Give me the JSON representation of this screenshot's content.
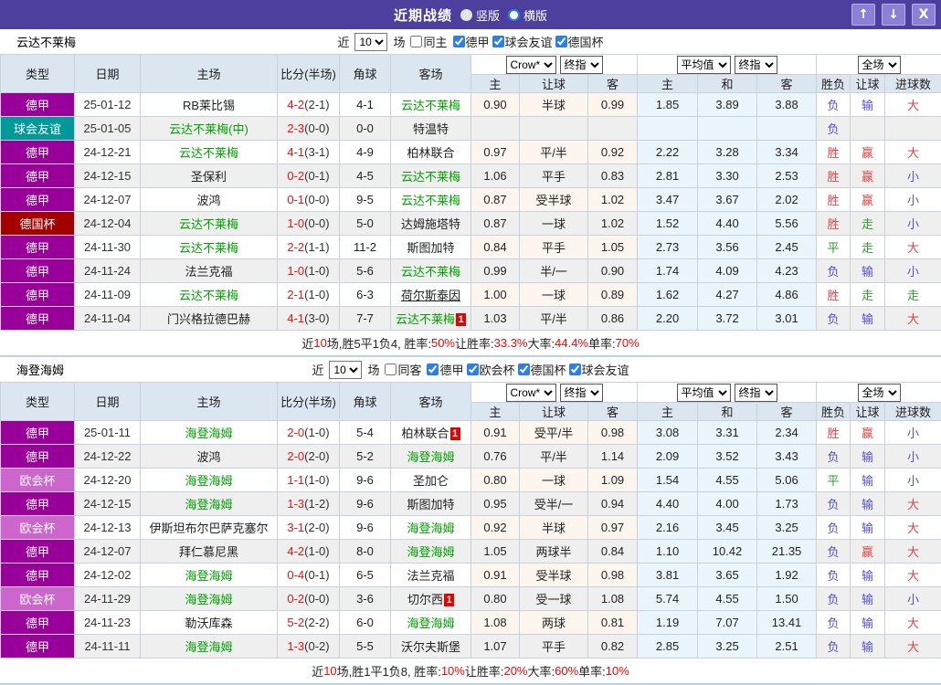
{
  "titlebar": {
    "title": "近期战绩",
    "radios": [
      {
        "label": "竖版",
        "selected": true
      },
      {
        "label": "横版",
        "selected": false
      }
    ],
    "buttons": {
      "up": "↑",
      "down": "↓",
      "close": "X"
    }
  },
  "filter_labels": {
    "near": "近",
    "games": "场"
  },
  "hdr": {
    "cols": [
      "类型",
      "日期",
      "主场",
      "比分(半场)",
      "角球",
      "客场"
    ],
    "crow_sel": "Crow*",
    "end_sel": "终指",
    "avg_sel": "平均值",
    "full_sel": "全场",
    "sub": [
      "主",
      "让球",
      "客",
      "主",
      "和",
      "客",
      "胜负",
      "让球",
      "进球数"
    ]
  },
  "colors": {
    "titlebar": "#4c3f9d",
    "leagues": {
      "德甲": "#990099",
      "球会友谊": "#009999",
      "德国杯": "#a50000",
      "欧会杯": "#cc66cc"
    },
    "win_red": "#e04545",
    "lose_blue": "#5252cf",
    "walk_green": "#2f9e2f",
    "team_green": "#00a000",
    "score_red": "#f01010"
  },
  "sections": [
    {
      "team": "云达不莱梅",
      "count": "10",
      "same_label": "同主",
      "same_checked": false,
      "leagues": [
        {
          "label": "德甲",
          "checked": true
        },
        {
          "label": "球会友谊",
          "checked": true
        },
        {
          "label": "德国杯",
          "checked": true
        }
      ],
      "rows": [
        {
          "lg": "德甲",
          "dt": "25-01-12",
          "h": {
            "t": "RB莱比锡"
          },
          "s": "4-2",
          "hs": "(2-1)",
          "cn": "4-1",
          "a": {
            "t": "云达不莱梅",
            "g": 1
          },
          "cw": [
            "0.90",
            "半球",
            "0.99"
          ],
          "av": [
            "1.85",
            "3.89",
            "3.88"
          ],
          "rs": [
            [
              "负",
              "b"
            ],
            [
              "输",
              "b"
            ],
            [
              "大",
              "r"
            ]
          ]
        },
        {
          "lg": "球会友谊",
          "dt": "25-01-05",
          "h": {
            "t": "云达不莱梅(中)",
            "g": 1
          },
          "s": "2-3",
          "hs": "(0-0)",
          "cn": "0-0",
          "a": {
            "t": "特温特"
          },
          "cw": [
            "",
            "",
            ""
          ],
          "av": [
            "",
            "",
            ""
          ],
          "rs": [
            [
              "负",
              "b"
            ],
            [
              "",
              "b"
            ],
            [
              "",
              "r"
            ]
          ]
        },
        {
          "lg": "德甲",
          "dt": "24-12-21",
          "h": {
            "t": "云达不莱梅",
            "g": 1
          },
          "s": "4-1",
          "hs": "(3-1)",
          "cn": "4-9",
          "a": {
            "t": "柏林联合"
          },
          "cw": [
            "0.97",
            "平/半",
            "0.92"
          ],
          "av": [
            "2.22",
            "3.28",
            "3.34"
          ],
          "rs": [
            [
              "胜",
              "r"
            ],
            [
              "赢",
              "r"
            ],
            [
              "大",
              "r"
            ]
          ]
        },
        {
          "lg": "德甲",
          "dt": "24-12-15",
          "h": {
            "t": "圣保利"
          },
          "s": "0-2",
          "hs": "(0-1)",
          "cn": "4-5",
          "a": {
            "t": "云达不莱梅",
            "g": 1
          },
          "cw": [
            "1.06",
            "平手",
            "0.83"
          ],
          "av": [
            "2.81",
            "3.30",
            "2.53"
          ],
          "rs": [
            [
              "胜",
              "r"
            ],
            [
              "赢",
              "r"
            ],
            [
              "小",
              "b"
            ]
          ]
        },
        {
          "lg": "德甲",
          "dt": "24-12-07",
          "h": {
            "t": "波鸿"
          },
          "s": "0-1",
          "hs": "(0-0)",
          "cn": "9-5",
          "a": {
            "t": "云达不莱梅",
            "g": 1
          },
          "cw": [
            "0.87",
            "受半球",
            "1.02"
          ],
          "av": [
            "3.47",
            "3.67",
            "2.02"
          ],
          "rs": [
            [
              "胜",
              "r"
            ],
            [
              "赢",
              "r"
            ],
            [
              "小",
              "b"
            ]
          ]
        },
        {
          "lg": "德国杯",
          "dt": "24-12-04",
          "h": {
            "t": "云达不莱梅",
            "g": 1
          },
          "s": "1-0",
          "hs": "(0-0)",
          "cn": "5-0",
          "a": {
            "t": "达姆施塔特"
          },
          "cw": [
            "0.87",
            "一球",
            "1.02"
          ],
          "av": [
            "1.52",
            "4.40",
            "5.56"
          ],
          "rs": [
            [
              "胜",
              "r"
            ],
            [
              "走",
              "g"
            ],
            [
              "小",
              "b"
            ]
          ]
        },
        {
          "lg": "德甲",
          "dt": "24-11-30",
          "h": {
            "t": "云达不莱梅",
            "g": 1
          },
          "s": "2-2",
          "hs": "(1-1)",
          "cn": "11-2",
          "a": {
            "t": "斯图加特"
          },
          "cw": [
            "0.84",
            "平手",
            "1.05"
          ],
          "av": [
            "2.73",
            "3.56",
            "2.45"
          ],
          "rs": [
            [
              "平",
              "g"
            ],
            [
              "走",
              "g"
            ],
            [
              "大",
              "r"
            ]
          ]
        },
        {
          "lg": "德甲",
          "dt": "24-11-24",
          "h": {
            "t": "法兰克福"
          },
          "s": "1-0",
          "hs": "(1-0)",
          "cn": "5-6",
          "a": {
            "t": "云达不莱梅",
            "g": 1
          },
          "cw": [
            "0.99",
            "半/一",
            "0.90"
          ],
          "av": [
            "1.74",
            "4.09",
            "4.23"
          ],
          "rs": [
            [
              "负",
              "b"
            ],
            [
              "输",
              "b"
            ],
            [
              "小",
              "b"
            ]
          ]
        },
        {
          "lg": "德甲",
          "dt": "24-11-09",
          "h": {
            "t": "云达不莱梅",
            "g": 1
          },
          "s": "2-1",
          "hs": "(1-0)",
          "cn": "6-3",
          "a": {
            "t": "荷尔斯泰因",
            "u": 1
          },
          "cw": [
            "1.00",
            "一球",
            "0.89"
          ],
          "av": [
            "1.62",
            "4.27",
            "4.86"
          ],
          "rs": [
            [
              "胜",
              "r"
            ],
            [
              "走",
              "g"
            ],
            [
              "走",
              "g"
            ]
          ]
        },
        {
          "lg": "德甲",
          "dt": "24-11-04",
          "h": {
            "t": "门兴格拉德巴赫"
          },
          "s": "4-1",
          "hs": "(3-0)",
          "cn": "7-7",
          "a": {
            "t": "云达不莱梅",
            "g": 1,
            "b": 1
          },
          "cw": [
            "1.03",
            "平/半",
            "0.86"
          ],
          "av": [
            "2.20",
            "3.72",
            "3.01"
          ],
          "rs": [
            [
              "负",
              "b"
            ],
            [
              "输",
              "b"
            ],
            [
              "大",
              "r"
            ]
          ]
        }
      ],
      "summary": [
        {
          "t": "近"
        },
        {
          "t": "10",
          "r": 1
        },
        {
          "t": "场,胜5平1负4, 胜率:"
        },
        {
          "t": "50%",
          "r": 1
        },
        {
          "t": " 让胜率:"
        },
        {
          "t": "33.3%",
          "r": 1
        },
        {
          "t": " 大率:"
        },
        {
          "t": "44.4%",
          "r": 1
        },
        {
          "t": " 单率:"
        },
        {
          "t": "70%",
          "r": 1
        }
      ]
    },
    {
      "team": "海登海姆",
      "count": "10",
      "same_label": "同客",
      "same_checked": false,
      "leagues": [
        {
          "label": "德甲",
          "checked": true
        },
        {
          "label": "欧会杯",
          "checked": true
        },
        {
          "label": "德国杯",
          "checked": true
        },
        {
          "label": "球会友谊",
          "checked": true
        }
      ],
      "rows": [
        {
          "lg": "德甲",
          "dt": "25-01-11",
          "h": {
            "t": "海登海姆",
            "g": 1
          },
          "s": "2-0",
          "hs": "(1-0)",
          "cn": "5-4",
          "a": {
            "t": "柏林联合",
            "b": 1
          },
          "cw": [
            "0.91",
            "受平/半",
            "0.98"
          ],
          "av": [
            "3.08",
            "3.31",
            "2.34"
          ],
          "rs": [
            [
              "胜",
              "r"
            ],
            [
              "赢",
              "r"
            ],
            [
              "小",
              "b"
            ]
          ]
        },
        {
          "lg": "德甲",
          "dt": "24-12-22",
          "h": {
            "t": "波鸿"
          },
          "s": "2-0",
          "hs": "(2-0)",
          "cn": "5-2",
          "a": {
            "t": "海登海姆",
            "g": 1
          },
          "cw": [
            "0.76",
            "平/半",
            "1.14"
          ],
          "av": [
            "2.09",
            "3.52",
            "3.43"
          ],
          "rs": [
            [
              "负",
              "b"
            ],
            [
              "输",
              "b"
            ],
            [
              "小",
              "b"
            ]
          ]
        },
        {
          "lg": "欧会杯",
          "dt": "24-12-20",
          "h": {
            "t": "海登海姆",
            "g": 1
          },
          "s": "1-1",
          "hs": "(1-0)",
          "cn": "9-6",
          "a": {
            "t": "圣加仑"
          },
          "cw": [
            "0.80",
            "一球",
            "1.09"
          ],
          "av": [
            "1.54",
            "4.55",
            "5.06"
          ],
          "rs": [
            [
              "平",
              "g"
            ],
            [
              "输",
              "b"
            ],
            [
              "小",
              "b"
            ]
          ]
        },
        {
          "lg": "德甲",
          "dt": "24-12-15",
          "h": {
            "t": "海登海姆",
            "g": 1
          },
          "s": "1-3",
          "hs": "(1-2)",
          "cn": "9-6",
          "a": {
            "t": "斯图加特"
          },
          "cw": [
            "0.95",
            "受半/一",
            "0.94"
          ],
          "av": [
            "4.40",
            "4.00",
            "1.73"
          ],
          "rs": [
            [
              "负",
              "b"
            ],
            [
              "输",
              "b"
            ],
            [
              "大",
              "r"
            ]
          ]
        },
        {
          "lg": "欧会杯",
          "dt": "24-12-13",
          "h": {
            "t": "伊斯坦布尔巴萨克塞尔"
          },
          "s": "3-1",
          "hs": "(2-0)",
          "cn": "9-6",
          "a": {
            "t": "海登海姆",
            "g": 1
          },
          "cw": [
            "0.92",
            "半球",
            "0.97"
          ],
          "av": [
            "2.16",
            "3.45",
            "3.25"
          ],
          "rs": [
            [
              "负",
              "b"
            ],
            [
              "输",
              "b"
            ],
            [
              "大",
              "r"
            ]
          ]
        },
        {
          "lg": "德甲",
          "dt": "24-12-07",
          "h": {
            "t": "拜仁慕尼黑"
          },
          "s": "4-2",
          "hs": "(1-0)",
          "cn": "8-0",
          "a": {
            "t": "海登海姆",
            "g": 1
          },
          "cw": [
            "1.05",
            "两球半",
            "0.84"
          ],
          "av": [
            "1.10",
            "10.42",
            "21.35"
          ],
          "rs": [
            [
              "负",
              "b"
            ],
            [
              "赢",
              "r"
            ],
            [
              "大",
              "r"
            ]
          ]
        },
        {
          "lg": "德甲",
          "dt": "24-12-02",
          "h": {
            "t": "海登海姆",
            "g": 1
          },
          "s": "0-4",
          "hs": "(0-1)",
          "cn": "6-5",
          "a": {
            "t": "法兰克福"
          },
          "cw": [
            "0.91",
            "受半球",
            "0.98"
          ],
          "av": [
            "3.81",
            "3.65",
            "1.92"
          ],
          "rs": [
            [
              "负",
              "b"
            ],
            [
              "输",
              "b"
            ],
            [
              "大",
              "r"
            ]
          ]
        },
        {
          "lg": "欧会杯",
          "dt": "24-11-29",
          "h": {
            "t": "海登海姆",
            "g": 1
          },
          "s": "0-2",
          "hs": "(0-0)",
          "cn": "3-6",
          "a": {
            "t": "切尔西",
            "b": 1
          },
          "cw": [
            "0.80",
            "受一球",
            "1.08"
          ],
          "av": [
            "5.74",
            "4.55",
            "1.50"
          ],
          "rs": [
            [
              "负",
              "b"
            ],
            [
              "输",
              "b"
            ],
            [
              "小",
              "b"
            ]
          ]
        },
        {
          "lg": "德甲",
          "dt": "24-11-23",
          "h": {
            "t": "勒沃库森"
          },
          "s": "5-2",
          "hs": "(2-2)",
          "cn": "6-0",
          "a": {
            "t": "海登海姆",
            "g": 1
          },
          "cw": [
            "1.08",
            "两球",
            "0.81"
          ],
          "av": [
            "1.19",
            "7.07",
            "13.41"
          ],
          "rs": [
            [
              "负",
              "b"
            ],
            [
              "输",
              "b"
            ],
            [
              "大",
              "r"
            ]
          ]
        },
        {
          "lg": "德甲",
          "dt": "24-11-11",
          "h": {
            "t": "海登海姆",
            "g": 1
          },
          "s": "1-3",
          "hs": "(0-2)",
          "cn": "5-5",
          "a": {
            "t": "沃尔夫斯堡"
          },
          "cw": [
            "1.07",
            "平手",
            "0.82"
          ],
          "av": [
            "2.85",
            "3.25",
            "2.51"
          ],
          "rs": [
            [
              "负",
              "b"
            ],
            [
              "输",
              "b"
            ],
            [
              "大",
              "r"
            ]
          ]
        }
      ],
      "summary": [
        {
          "t": "近"
        },
        {
          "t": "10",
          "r": 1
        },
        {
          "t": "场,胜1平1负8, 胜率:"
        },
        {
          "t": "10%",
          "r": 1
        },
        {
          "t": " 让胜率:"
        },
        {
          "t": "20%",
          "r": 1
        },
        {
          "t": " 大率:"
        },
        {
          "t": "60%",
          "r": 1
        },
        {
          "t": " 单率:"
        },
        {
          "t": "10%",
          "r": 1
        }
      ]
    }
  ]
}
